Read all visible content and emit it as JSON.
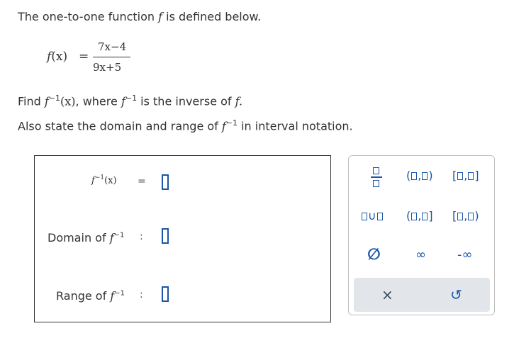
{
  "question": {
    "intro": "The one-to-one function ",
    "intro_f": "f",
    "intro_tail": " is defined below.",
    "def_lhs": "f",
    "def_lhs_x": "(x)",
    "def_eq": "=",
    "def_num": "7x−4",
    "def_den": "9x+5",
    "find_1": "Find ",
    "find_f": "f",
    "find_sup": "−1",
    "find_x": "(x)",
    "find_2": ", where ",
    "find_f2": "f",
    "find_sup2": "−1",
    "find_3": " is the inverse of ",
    "find_f3": "f.",
    "also_1": "Also state the domain and range of ",
    "also_f": "f",
    "also_sup": "−1",
    "also_2": " in interval notation."
  },
  "answer": {
    "inverse_f": "f",
    "inverse_sup": "−1",
    "inverse_x": "(x)",
    "inverse_eq": "=",
    "domain_label": "Domain of ",
    "domain_f": "f",
    "domain_sup": "−1",
    "domain_colon": ":",
    "range_label": "Range of ",
    "range_f": "f",
    "range_sup": "−1",
    "range_colon": ":"
  },
  "palette": {
    "open_open_l": "(",
    "open_open_c": ",",
    "open_open_r": ")",
    "closed_closed_l": "[",
    "closed_closed_c": ",",
    "closed_closed_r": "]",
    "union": "∪",
    "open_closed_l": "(",
    "open_closed_c": ",",
    "open_closed_r": "]",
    "closed_open_l": "[",
    "closed_open_c": ",",
    "closed_open_r": ")",
    "empty_set": "∅",
    "infinity": "∞",
    "neg_infinity": "-∞",
    "clear": "×",
    "undo": "↺"
  },
  "colors": {
    "accent": "#1a56a8",
    "text": "#333333",
    "footer_bg": "#e2e6ea"
  }
}
